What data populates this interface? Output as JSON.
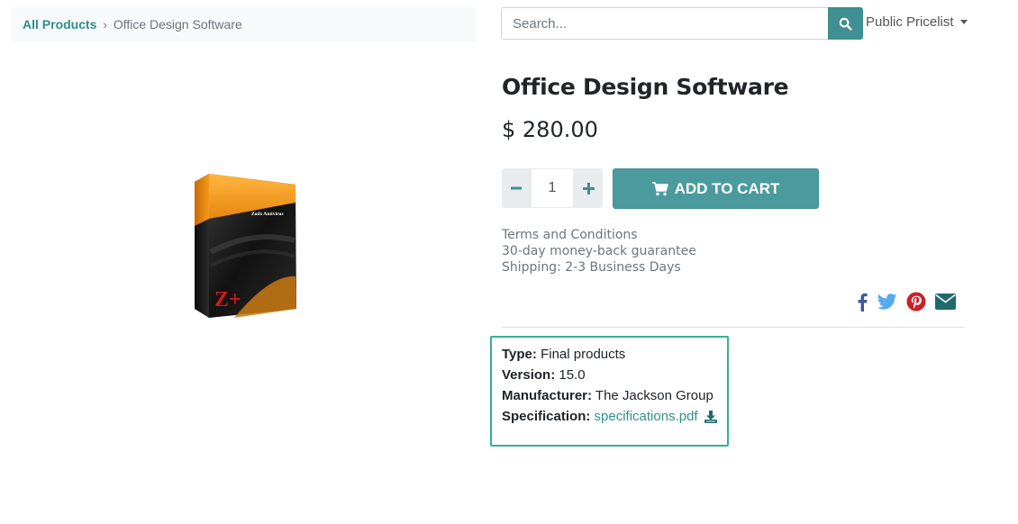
{
  "breadcrumb": {
    "root": "All Products",
    "separator": "›",
    "current": "Office Design Software"
  },
  "search": {
    "placeholder": "Search...",
    "value": ""
  },
  "pricelist": {
    "label": "Public Pricelist"
  },
  "product": {
    "title": "Office Design Software",
    "price": "$ 280.00",
    "image_box_text": "Zodx Antivirus",
    "image_logo": "Z+"
  },
  "quantity": {
    "value": "1",
    "minus": "−",
    "plus": "+"
  },
  "cart": {
    "label": "ADD TO CART"
  },
  "terms": [
    "Terms and Conditions",
    "30-day money-back guarantee",
    "Shipping: 2-3 Business Days"
  ],
  "share": {
    "icons": [
      "facebook-icon",
      "twitter-icon",
      "pinterest-icon",
      "envelope-icon"
    ]
  },
  "attributes": {
    "type_label": "Type:",
    "type_value": "Final products",
    "version_label": "Version:",
    "version_value": "15.0",
    "manufacturer_label": "Manufacturer:",
    "manufacturer_value": "The Jackson Group",
    "spec_label": "Specification:",
    "spec_value": "specifications.pdf"
  },
  "colors": {
    "accent": "#3f8f94",
    "highlight_border": "#2fb391",
    "facebook": "#3b5998",
    "twitter": "#55acee",
    "pinterest": "#cb2027",
    "email": "#1f6b6b"
  }
}
